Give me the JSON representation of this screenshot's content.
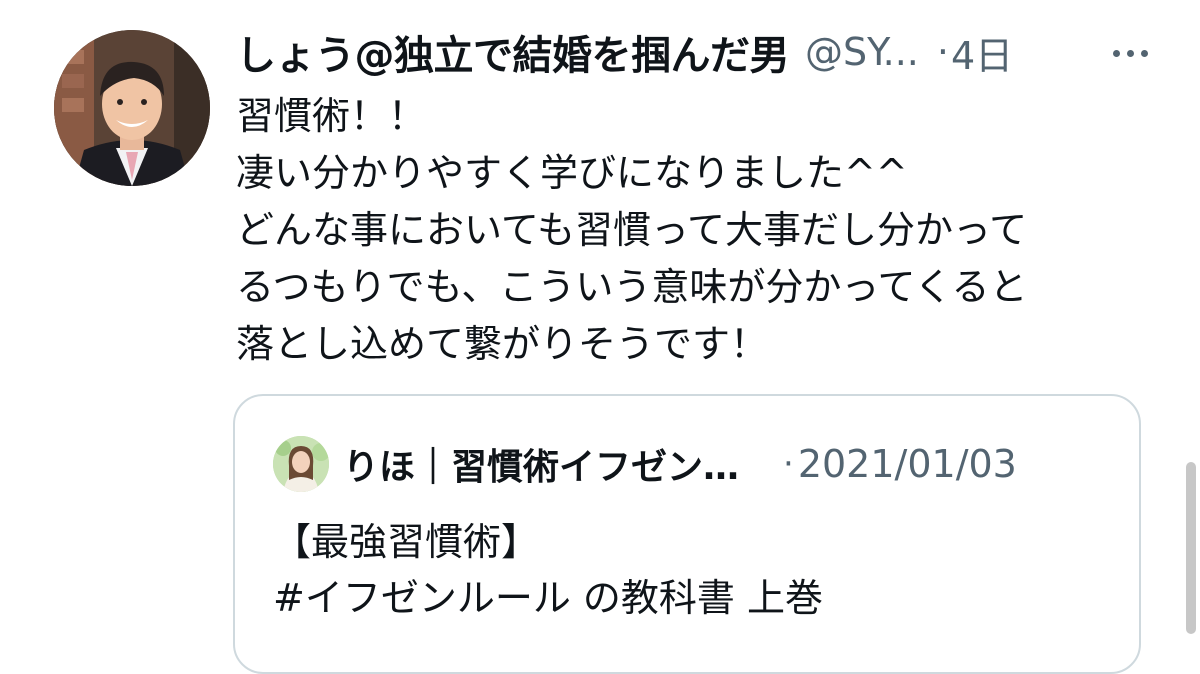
{
  "tweet": {
    "display_name": "しょう@独立で結婚を掴んだ男",
    "handle": "@SY...",
    "dot": "·",
    "time": "4日",
    "more_icon": "more-horizontal-icon",
    "lines": [
      "習慣術！！",
      "凄い分かりやすく学びになりました^^",
      "どんな事においても習慣って大事だし分かって",
      "るつもりでも、こういう意味が分かってくると",
      "落とし込めて繋がりそうです！"
    ]
  },
  "quote": {
    "name": "りほ｜習慣術イフゼン…",
    "dot": "·",
    "time": "2021/01/03",
    "lines": [
      "【最強習慣術】",
      "#イフゼンルール の教科書 上巻"
    ]
  },
  "colors": {
    "text": "#0f1419",
    "secondary": "#536471",
    "border": "#cfd9de"
  }
}
